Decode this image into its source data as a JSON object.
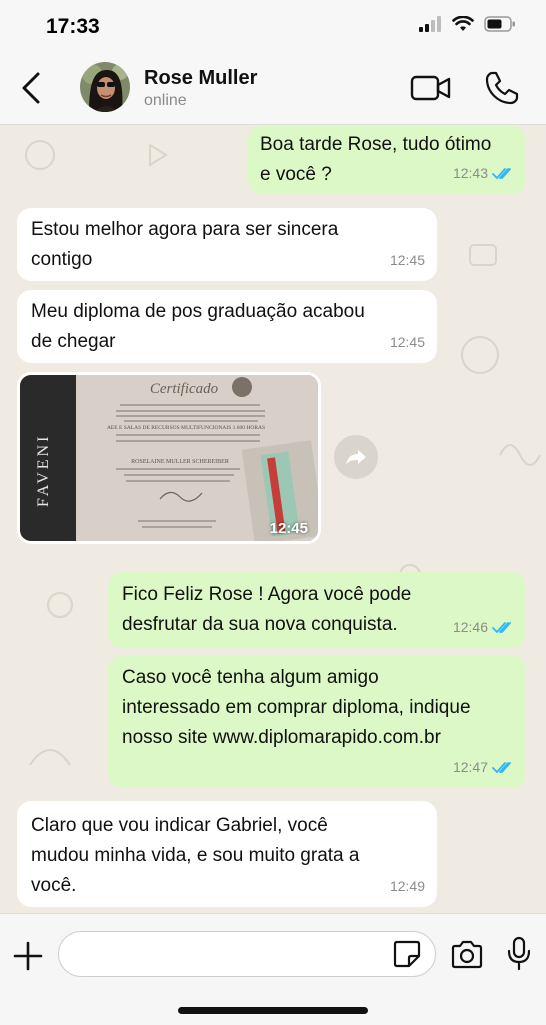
{
  "status_bar": {
    "time": "17:33"
  },
  "header": {
    "contact_name": "Rose Muller",
    "contact_status": "online"
  },
  "messages": [
    {
      "direction": "out",
      "text": "Boa tarde Rose, tudo ótimo\n e você ?",
      "time": "12:43",
      "read": true
    },
    {
      "direction": "in",
      "text": "Estou melhor agora para ser sincera\ncontigo",
      "time": "12:45"
    },
    {
      "direction": "in",
      "text": "Meu diploma de pos graduação acabou\nde chegar",
      "time": "12:45"
    },
    {
      "direction": "in",
      "type": "image",
      "time": "12:45",
      "certificate": {
        "title": "Certificado",
        "course": "AEE E SALAS DE RECURSOS MULTIFUNCIONAIS 1.600 HORAS",
        "holder": "ROSELAINE MULLER SCHEREIBER",
        "side_text": "FAVENI"
      }
    },
    {
      "direction": "out",
      "text": "Fico Feliz Rose ! Agora você pode\ndesfrutar da sua nova conquista.",
      "time": "12:46",
      "read": true
    },
    {
      "direction": "out",
      "text": "Caso você tenha algum amigo\ninteressado em comprar diploma, indique\nnosso site www.diplomarapido.com.br",
      "time": "12:47",
      "read": true
    },
    {
      "direction": "in",
      "text": "Claro que vou indicar Gabriel, você\nmudou minha vida, e sou muito grata a\nvocê.",
      "time": "12:49"
    }
  ],
  "input": {
    "placeholder": "",
    "value": ""
  },
  "colors": {
    "outgoing_bubble": "#dcf8c6",
    "incoming_bubble": "#ffffff",
    "chat_background": "#efeae2",
    "read_ticks": "#34b7f1"
  },
  "icons": [
    "back-chevron-icon",
    "video-camera-icon",
    "phone-icon",
    "forward-icon",
    "plus-icon",
    "sticker-icon",
    "camera-icon",
    "microphone-icon",
    "double-check-icon"
  ]
}
